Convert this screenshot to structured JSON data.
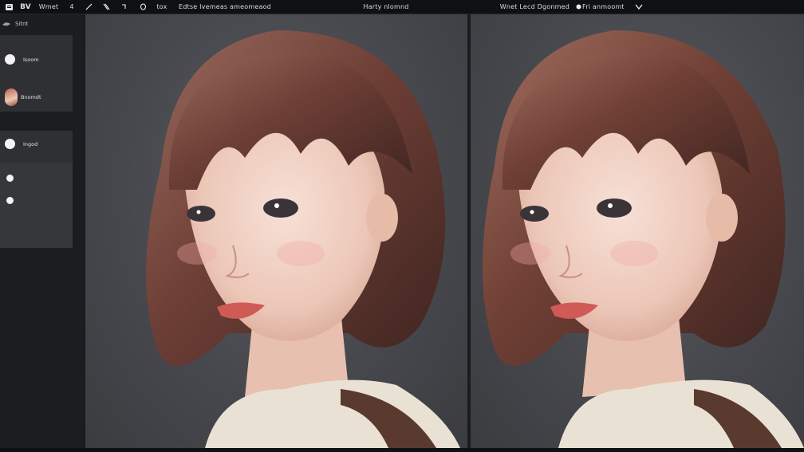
{
  "toolbar": {
    "logo_text": "BV",
    "menu_label": "Wmet",
    "number_label": "4",
    "tool_label": "tox",
    "tabs_label": "Edtse  Ivemeas  ameomeaod",
    "center_title": "Harty nlomnd",
    "right_label": "Wnet Lecd  Dgonmed",
    "right_status": "Fri anmoomt"
  },
  "sidebar": {
    "header": "Sitnt",
    "layers": [
      {
        "label": "Isoom"
      },
      {
        "label": "Bnomdt"
      },
      {
        "label": "Ingod"
      }
    ]
  },
  "canvas": {
    "left_pane": "original-portrait",
    "right_pane": "edited-portrait"
  },
  "colors": {
    "background": "#1a1b1e",
    "panel": "#2f3034",
    "canvas": "#47484d",
    "hair": "#6e3f36",
    "skin": "#f0d2c6",
    "sweater": "#e9e2d4"
  }
}
